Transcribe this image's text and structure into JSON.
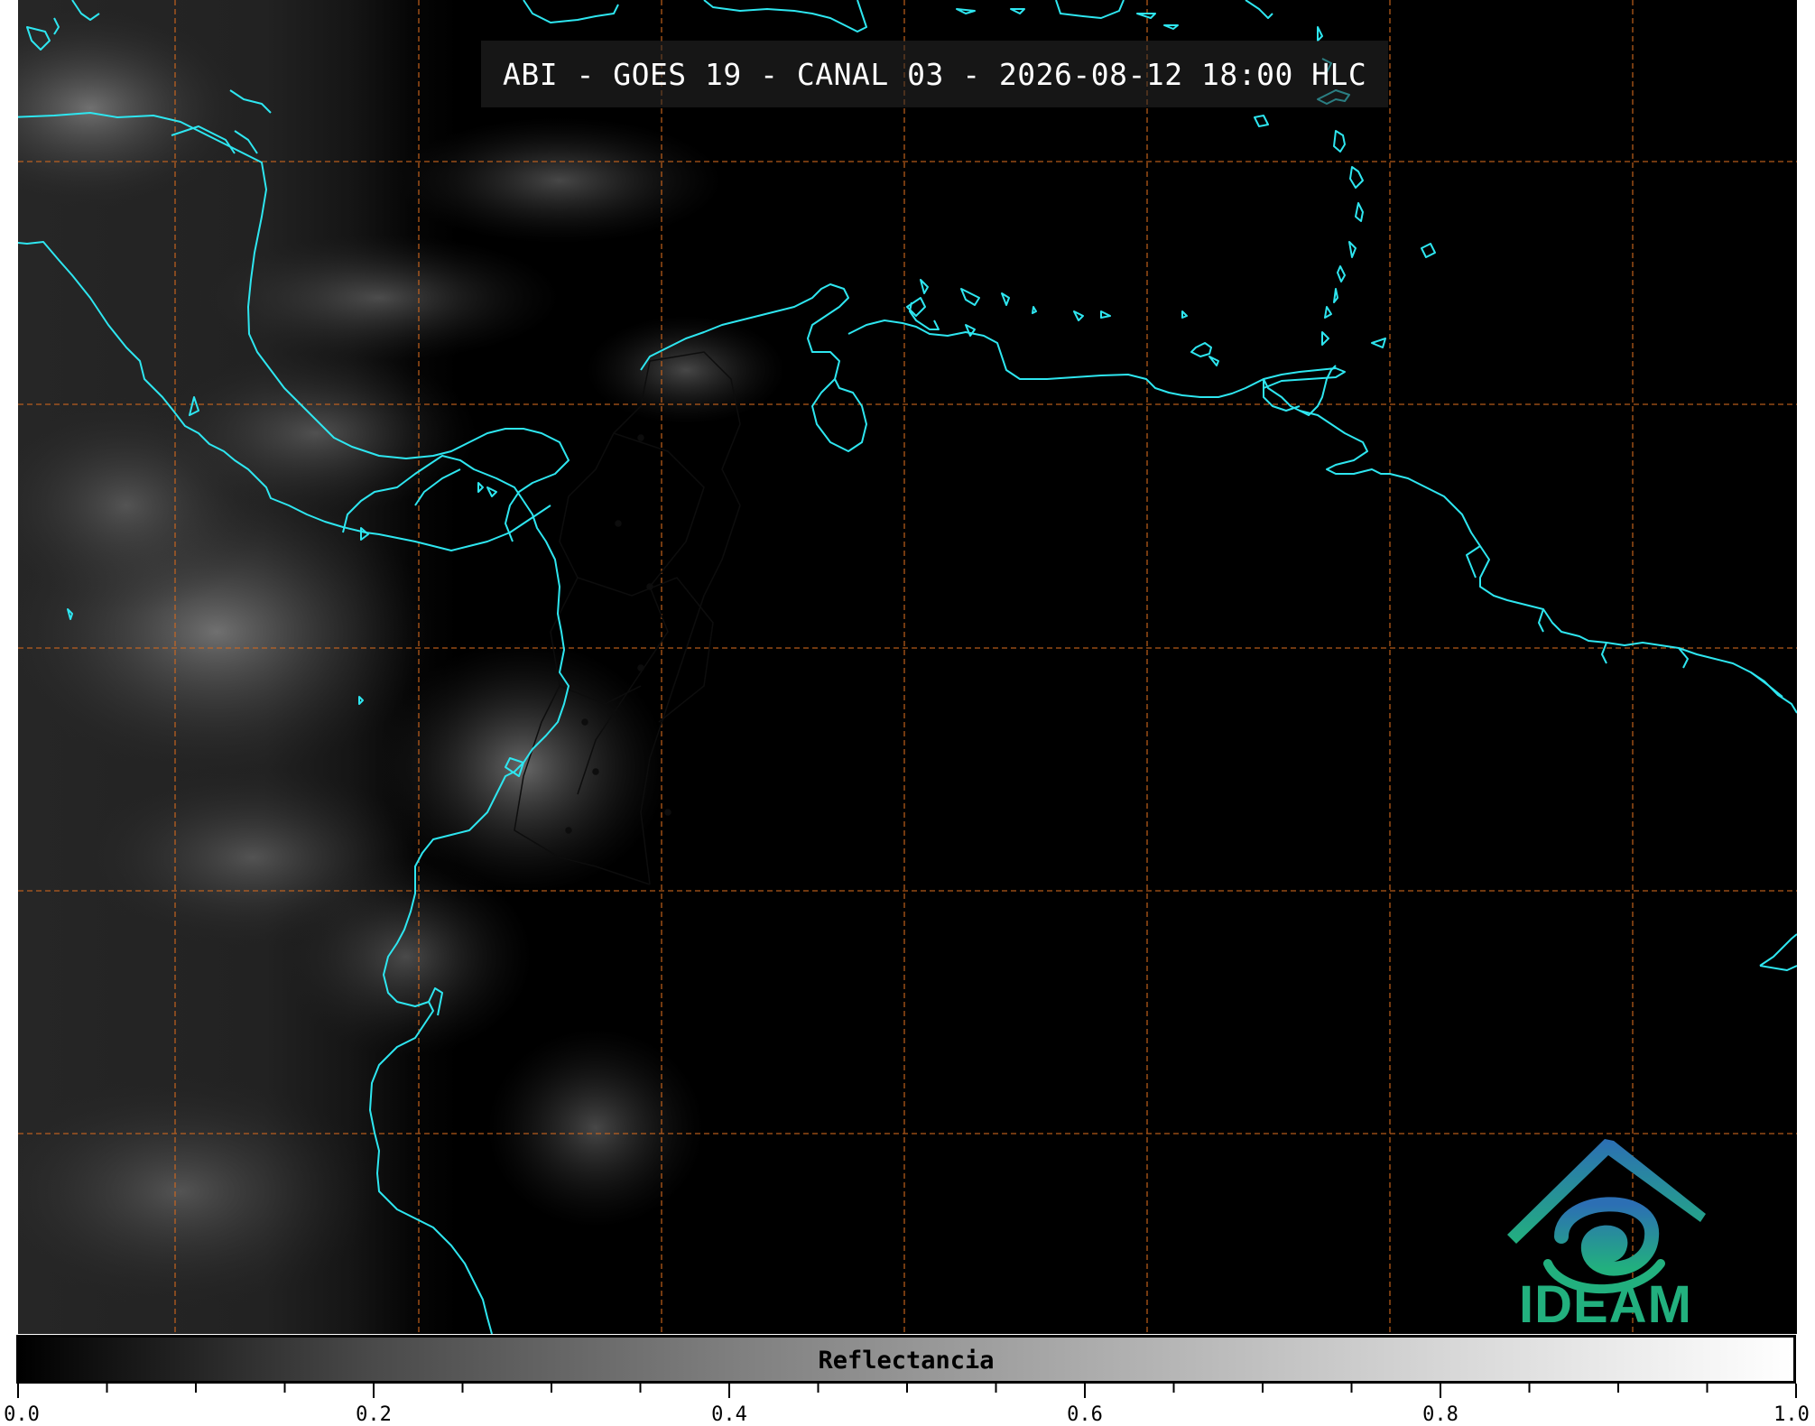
{
  "map": {
    "title": "ABI - GOES 19 - CANAL 03 - 2026-08-12 18:00 HLC",
    "background_color": "#000000",
    "coastline_color": "#2ee6f0",
    "gridline_color": "#d2691e",
    "border_color": "#1a1a1a",
    "gridlines": "dashed"
  },
  "logo": {
    "text": "IDEAM",
    "icon": "ideam-logo-icon",
    "text_color": "#22b07e",
    "gradient": [
      "#2c6fb4",
      "#22b07e"
    ]
  },
  "colorbar": {
    "label": "Reflectancia",
    "range": [
      0.0,
      1.0
    ],
    "tick_labels": [
      "0.0",
      "0.2",
      "0.4",
      "0.6",
      "0.8",
      "1.0"
    ],
    "tick_values": [
      0.0,
      0.2,
      0.4,
      0.6,
      0.8,
      1.0
    ],
    "minor_step": 0.05,
    "colors": [
      "#000000",
      "#ffffff"
    ]
  }
}
